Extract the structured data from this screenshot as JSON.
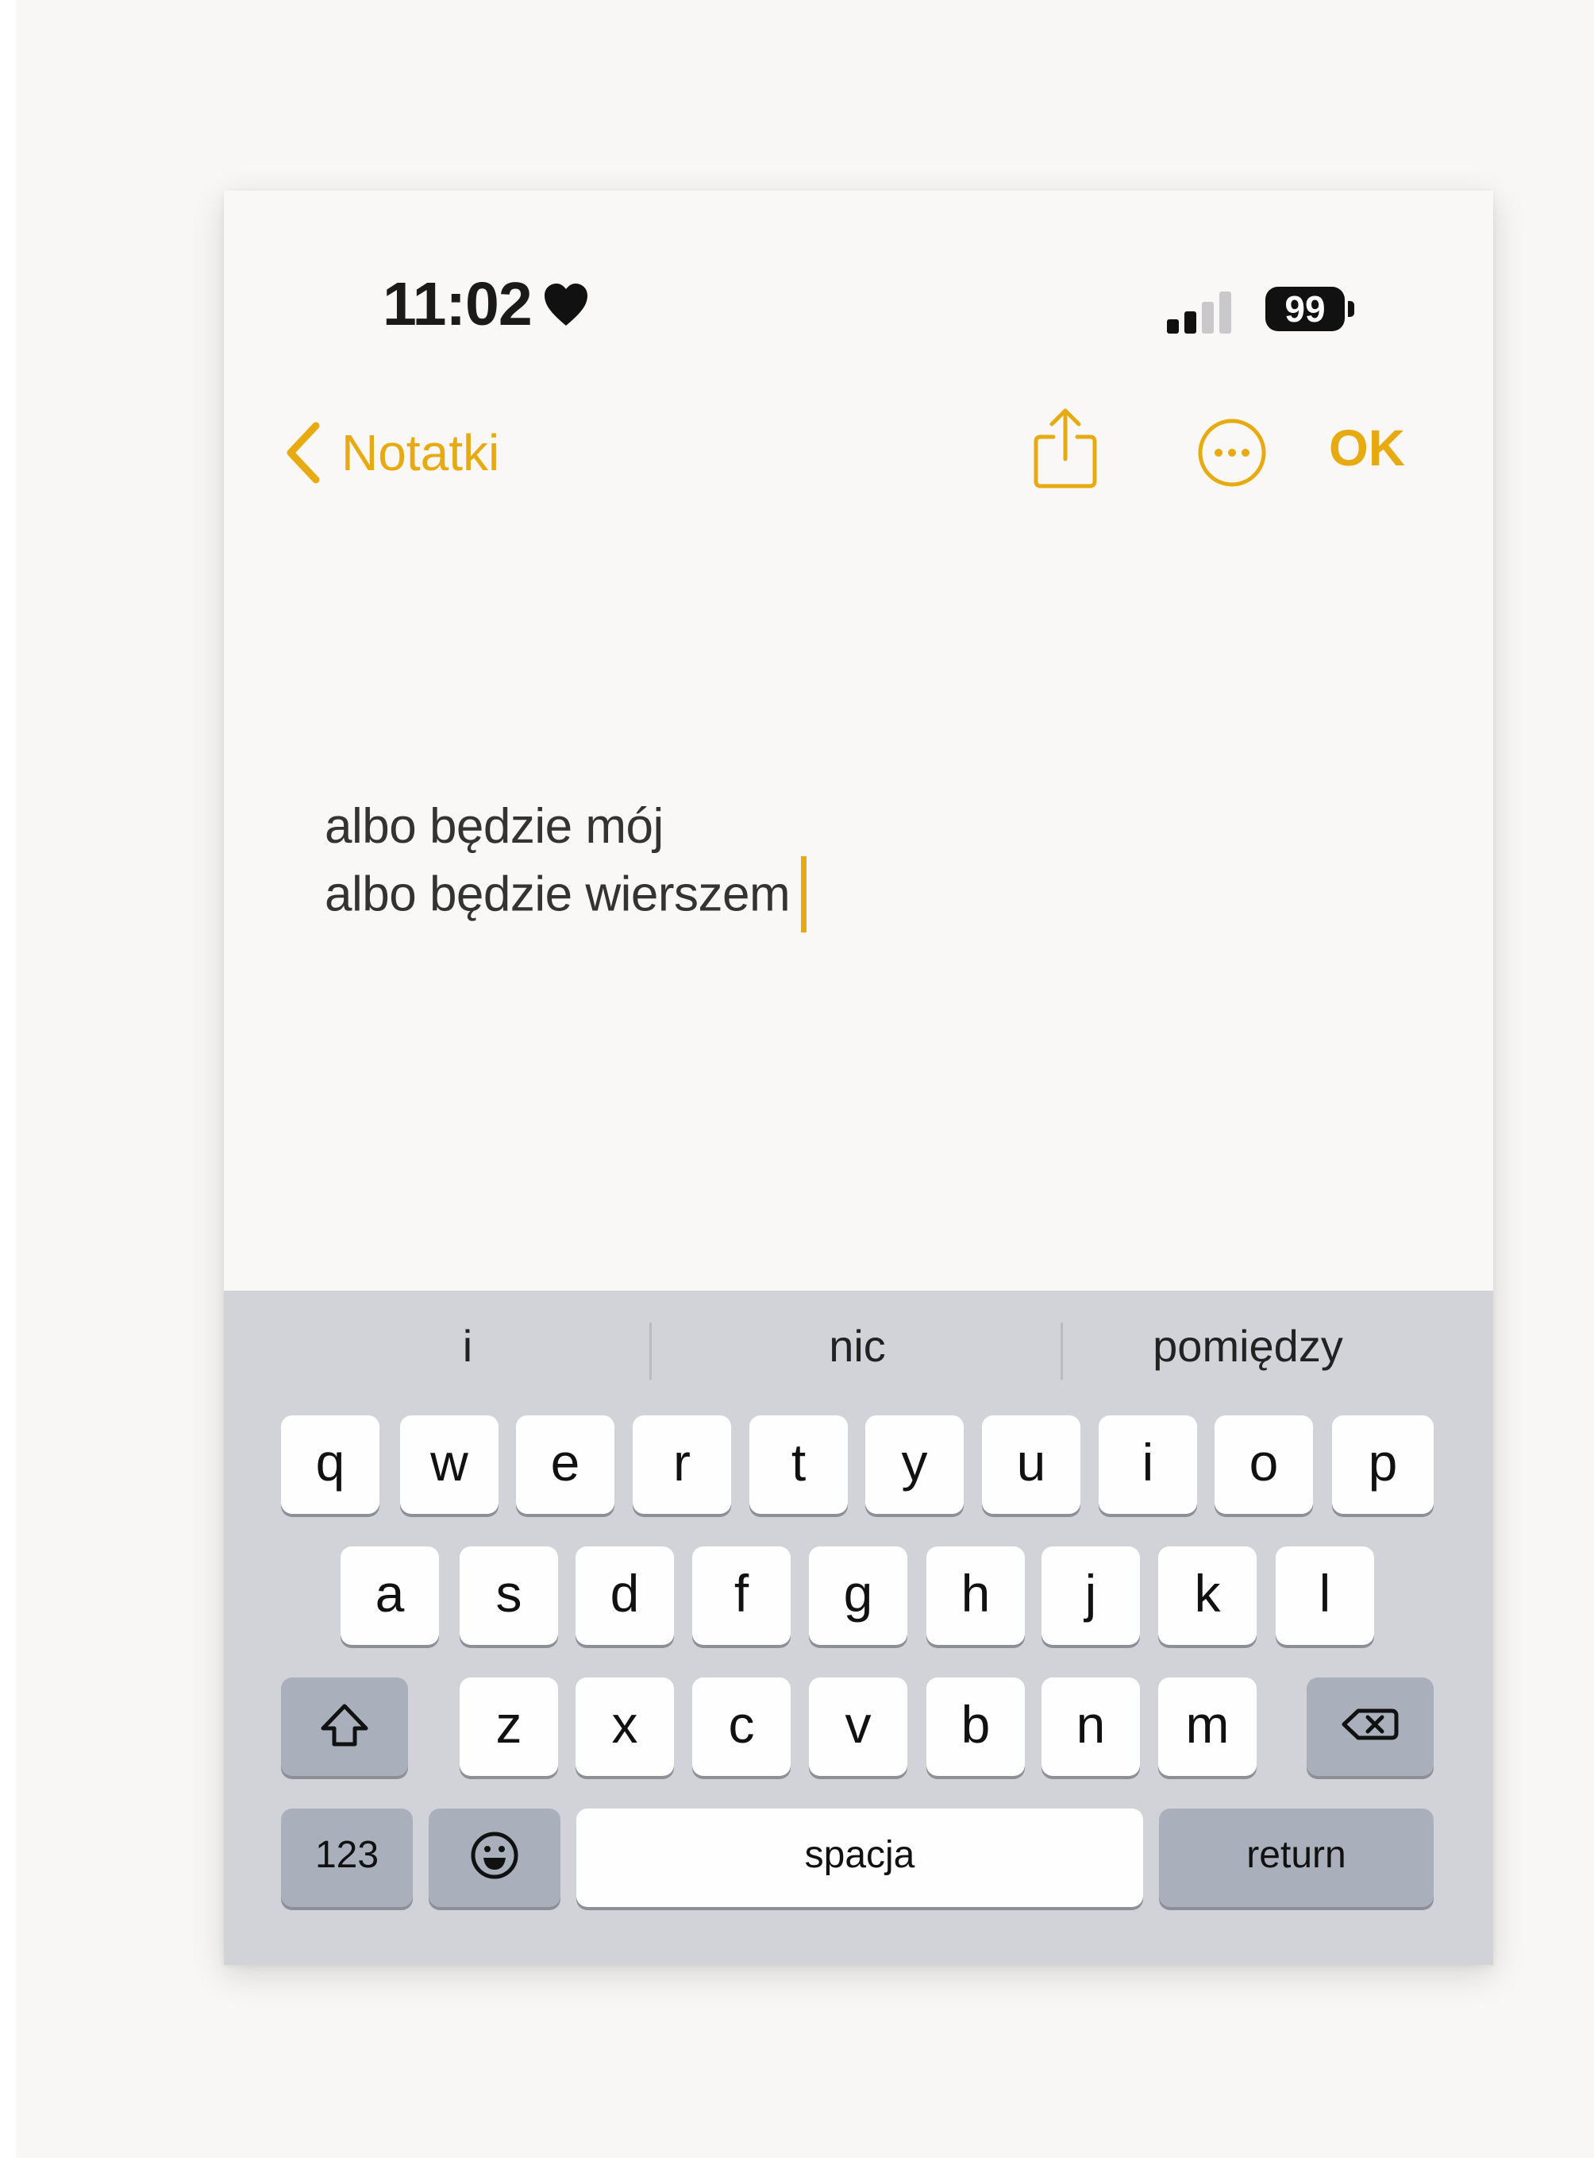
{
  "status_bar": {
    "time": "11:02",
    "battery": "99",
    "signal_bars_active": 2,
    "signal_bars_total": 4
  },
  "nav": {
    "back_label": "Notatki",
    "done_label": "OK"
  },
  "note": {
    "lines": [
      "albo będzie mój",
      "albo będzie wierszem"
    ]
  },
  "keyboard": {
    "suggestions": [
      "i",
      "nic",
      "pomiędzy"
    ],
    "row1": [
      "q",
      "w",
      "e",
      "r",
      "t",
      "y",
      "u",
      "i",
      "o",
      "p"
    ],
    "row2": [
      "a",
      "s",
      "d",
      "f",
      "g",
      "h",
      "j",
      "k",
      "l"
    ],
    "row3": [
      "z",
      "x",
      "c",
      "v",
      "b",
      "n",
      "m"
    ],
    "numbers_label": "123",
    "space_label": "spacja",
    "return_label": "return"
  },
  "colors": {
    "accent": "#e7aa10",
    "keyboard_bg": "#d1d3d9",
    "dark_key": "#a9b0bb",
    "page_bg": "#f9f8f6"
  }
}
